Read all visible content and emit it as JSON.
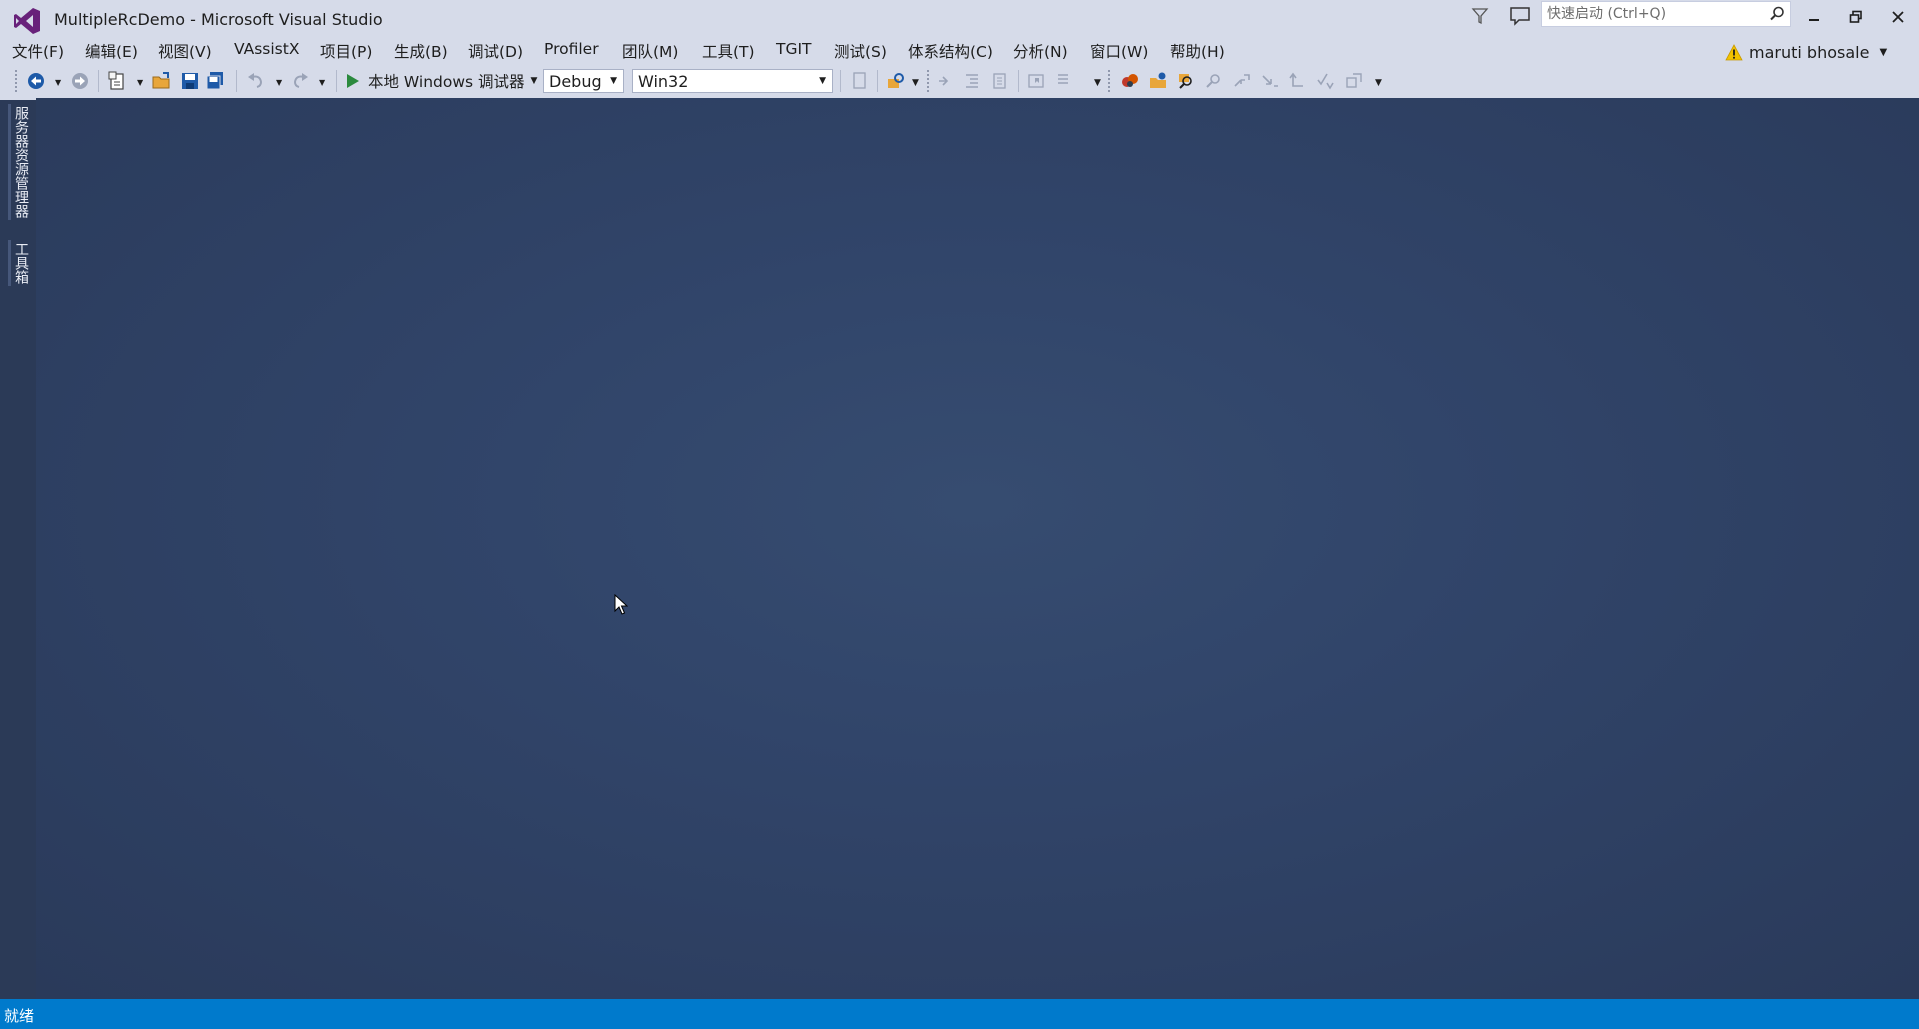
{
  "window": {
    "title": "MultipleRcDemo - Microsoft Visual Studio",
    "logo_icon": "visual-studio-logo",
    "search_placeholder": "快速启动 (Ctrl+Q)"
  },
  "menu": {
    "items": [
      {
        "label": "文件(F)"
      },
      {
        "label": "编辑(E)"
      },
      {
        "label": "视图(V)"
      },
      {
        "label": "VAssistX"
      },
      {
        "label": "项目(P)"
      },
      {
        "label": "生成(B)"
      },
      {
        "label": "调试(D)"
      },
      {
        "label": "Profiler"
      },
      {
        "label": "团队(M)"
      },
      {
        "label": "工具(T)"
      },
      {
        "label": "TGIT"
      },
      {
        "label": "测试(S)"
      },
      {
        "label": "体系结构(C)"
      },
      {
        "label": "分析(N)"
      },
      {
        "label": "窗口(W)"
      },
      {
        "label": "帮助(H)"
      }
    ]
  },
  "account": {
    "name": "maruti bhosale",
    "icon": "warning-icon"
  },
  "toolbar": {
    "run_label": "本地 Windows 调试器",
    "configuration": "Debug",
    "platform": "Win32"
  },
  "left_strip": {
    "tabs": [
      {
        "label": "服务器资源管理器"
      },
      {
        "label": "工具箱"
      }
    ]
  },
  "status": {
    "text": "就绪"
  },
  "colors": {
    "chrome": "#d6dbe9",
    "workspace": "#2e4060",
    "statusbar": "#007acc"
  }
}
